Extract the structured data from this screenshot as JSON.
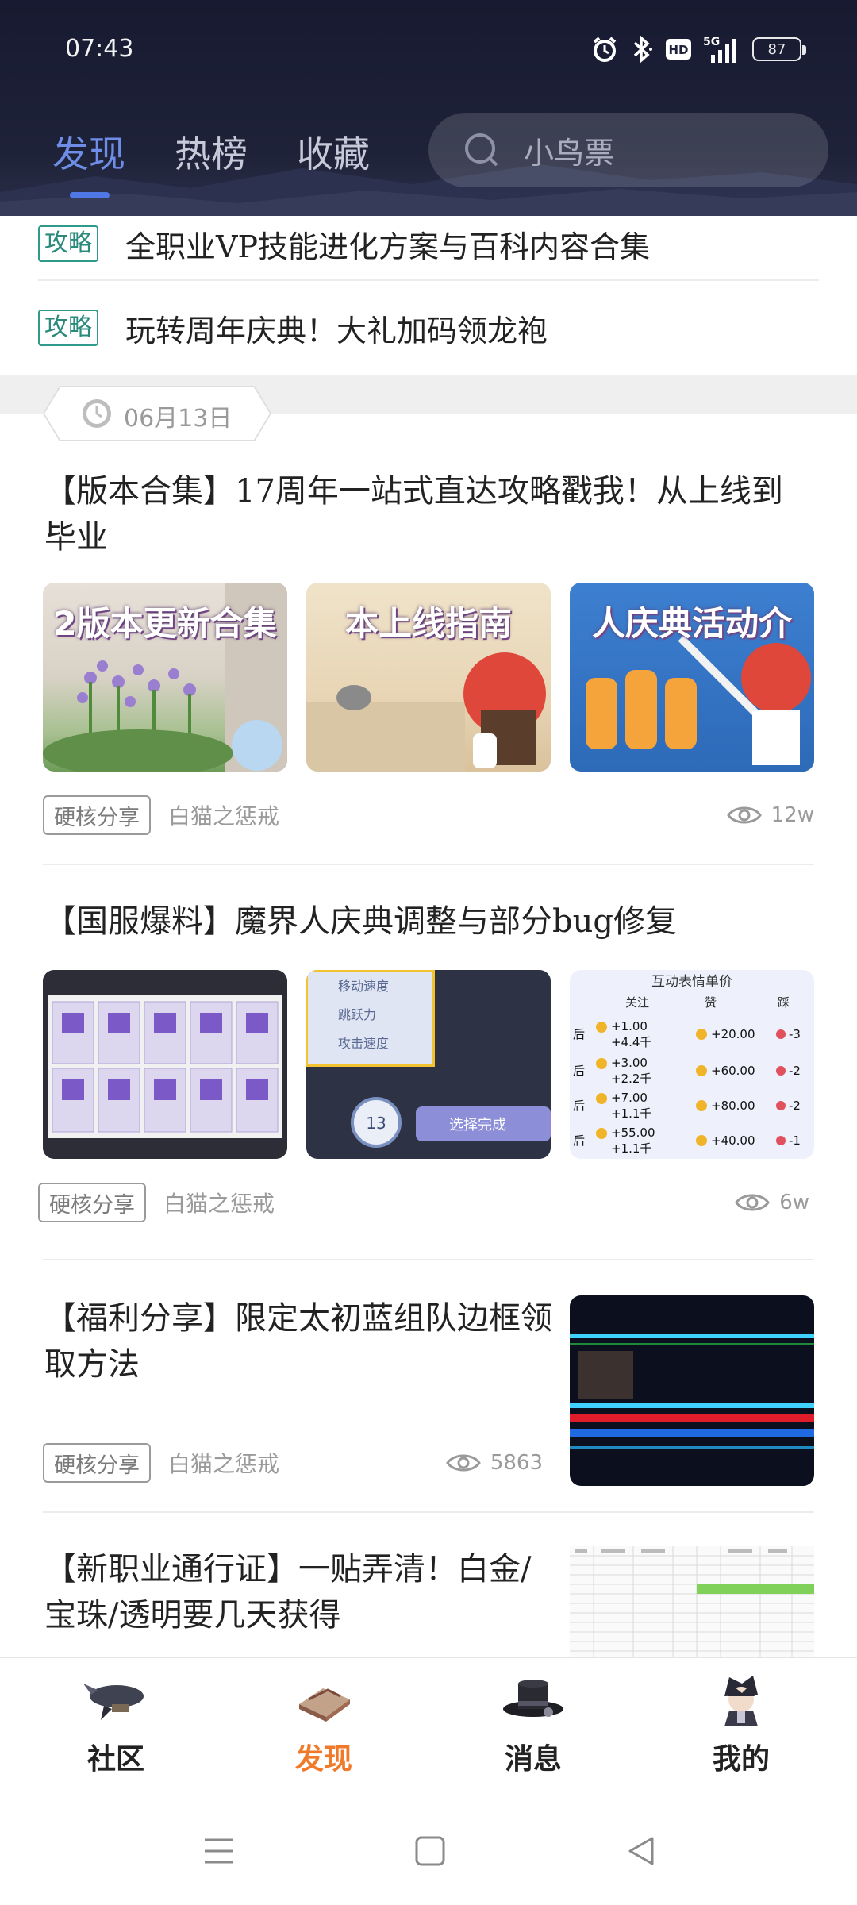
{
  "status_bar": {
    "time": "07:43",
    "battery": "87",
    "icons": [
      "alarm-icon",
      "bluetooth-icon",
      "hd-icon",
      "signal-5g-icon",
      "battery-icon"
    ],
    "hd": "HD",
    "network": "5G"
  },
  "header": {
    "tabs": [
      {
        "label": "发现",
        "active": true
      },
      {
        "label": "热榜",
        "active": false
      },
      {
        "label": "收藏",
        "active": false
      }
    ],
    "search_placeholder": "小鸟票"
  },
  "guides": [
    {
      "tag": "攻略",
      "text": "全职业VP技能进化方案与百科内容合集"
    },
    {
      "tag": "攻略",
      "text": "玩转周年庆典！大礼加码领龙袍"
    }
  ],
  "date_badge": "06月13日",
  "posts": [
    {
      "title": "【版本合集】17周年一站式直达攻略戳我！从上线到毕业",
      "thumbnails": [
        "2版本更新合集",
        "本上线指南",
        "人庆典活动介"
      ],
      "category": "硬核分享",
      "author": "白猫之惩戒",
      "views": "12w"
    },
    {
      "title": "【国服爆料】魔界人庆典调整与部分bug修复",
      "thumbnails": [
        "",
        "选择完成",
        "互动表情单价"
      ],
      "thumb2_labels": [
        "移动速度",
        "跳跃力",
        "攻击速度",
        "13"
      ],
      "thumb3_header": [
        "关注",
        "赞",
        "踩"
      ],
      "thumb3_rows": [
        {
          "side": "后",
          "follow": "+1.00",
          "fans": "+4.4千",
          "like": "+20.00",
          "dislike": "-3"
        },
        {
          "side": "后",
          "follow": "+3.00",
          "fans": "+2.2千",
          "like": "+60.00",
          "dislike": "-2"
        },
        {
          "side": "后",
          "follow": "+7.00",
          "fans": "+1.1千",
          "like": "+80.00",
          "dislike": "-2"
        },
        {
          "side": "后",
          "follow": "+55.00",
          "fans": "+1.1千",
          "like": "+40.00",
          "dislike": "-1"
        }
      ],
      "category": "硬核分享",
      "author": "白猫之惩戒",
      "views": "6w"
    },
    {
      "title": "【福利分享】限定太初蓝组队边框领取方法",
      "category": "硬核分享",
      "author": "白猫之惩戒",
      "views": "5863"
    },
    {
      "title": "【新职业通行证】一贴弄清！白金/宝珠/透明要几天获得"
    }
  ],
  "bottom_nav": [
    {
      "label": "社区",
      "icon": "airship-icon",
      "active": false
    },
    {
      "label": "发现",
      "icon": "book-icon",
      "active": true
    },
    {
      "label": "消息",
      "icon": "top-hat-icon",
      "active": false
    },
    {
      "label": "我的",
      "icon": "avatar-icon",
      "active": false
    }
  ],
  "colors": {
    "header_bg": "#1e2238",
    "active_tab": "#6d8de6",
    "tag_green": "#2f9a8b",
    "nav_active": "#f07a2a"
  }
}
